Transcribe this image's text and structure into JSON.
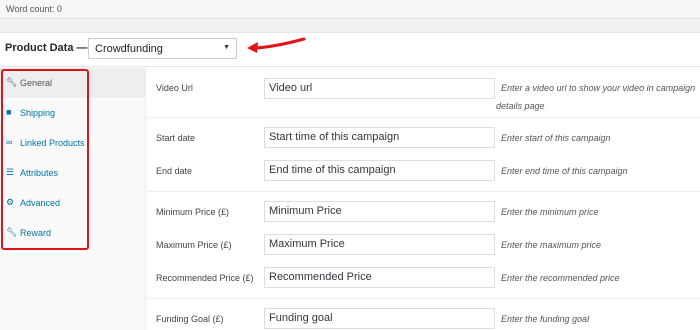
{
  "editor": {
    "word_count": "Word count: 0"
  },
  "product_data": {
    "label": "Product Data —",
    "selected_type": "Crowdfunding"
  },
  "tabs": [
    {
      "label": "General",
      "icon": "wrench-icon",
      "active": true
    },
    {
      "label": "Shipping",
      "icon": "truck-icon",
      "active": false
    },
    {
      "label": "Linked Products",
      "icon": "link-icon",
      "active": false
    },
    {
      "label": "Attributes",
      "icon": "list-icon",
      "active": false
    },
    {
      "label": "Advanced",
      "icon": "gear-icon",
      "active": false
    },
    {
      "label": "Reward",
      "icon": "wrench-icon",
      "active": false
    }
  ],
  "fields": {
    "video_url": {
      "label": "Video Url",
      "value": "Video url",
      "desc_line1": "Enter a video url to show your video in campaign",
      "desc_line2": "details page"
    },
    "start_date": {
      "label": "Start date",
      "value": "Start time of this campaign",
      "desc": "Enter start of this campaign"
    },
    "end_date": {
      "label": "End date",
      "value": "End time of this campaign",
      "desc": "Enter end time of this campaign"
    },
    "minimum_price": {
      "label": "Minimum Price (£)",
      "value": "Minimum Price",
      "desc": "Enter the minimum price"
    },
    "maximum_price": {
      "label": "Maximum Price (£)",
      "value": "Maximum Price",
      "desc": "Enter the maximum price"
    },
    "recommended_price": {
      "label": "Recommended Price (£)",
      "value": "Recommended Price",
      "desc": "Enter the recommended price"
    },
    "funding_goal": {
      "label": "Funding Goal (£)",
      "value": "Funding goal",
      "desc": "Enter the funding goal"
    }
  },
  "colors": {
    "annotation": "#e0131b",
    "link": "#0073aa"
  }
}
